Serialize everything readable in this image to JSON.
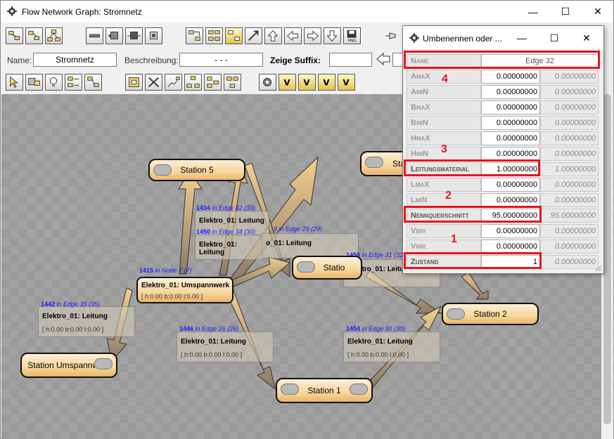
{
  "main_window": {
    "title": "Flow Network Graph: Stromnetz"
  },
  "toolbar": {
    "name_label": "Name:",
    "name_value": "Stromnetz",
    "description_label": "Beschreibung:",
    "description_value": "- - -",
    "suffix_label": "Zeige Suffix:",
    "suffix_value": ""
  },
  "graph": {
    "stations": [
      {
        "label": "Station 5"
      },
      {
        "label": "Station 2"
      },
      {
        "label": "Station 1"
      },
      {
        "label": "Station Umspannwerk"
      },
      {
        "label": "Statio"
      },
      {
        "label": "Sta"
      }
    ],
    "edge_cards": [
      {
        "title": "Elektro_01: Leitung",
        "values": "[ h:0.00 b:0.00 l:0.00 ]"
      },
      {
        "title": "Elektro_01: Leitung",
        "values": "[ h:0.00 b:0.00 l:0.00 ]"
      },
      {
        "title": "Elektro_01: Leitung",
        "values": "[ h:0.00 b:0.00 l:0.00 ]"
      },
      {
        "title": "Elektro_01: Umspannwerk",
        "values": "[ h:0.00 b:0.00 l:0.00 ]"
      },
      {
        "title": "Elektro_01: Leitung",
        "values": ""
      },
      {
        "title": "Elektro_01: Leitung",
        "values": ""
      },
      {
        "title": "o_01: Leitung",
        "values": ""
      },
      {
        "title": "Elektro_01: Leitung",
        "values": ""
      }
    ],
    "blue_labels": [
      {
        "id": "1442",
        "text": " in Edge 35 (35)"
      },
      {
        "id": "1415",
        "text": " in Node 7 (7)"
      },
      {
        "id": "1446",
        "text": " in Edge 26 (26)"
      },
      {
        "id": "1454",
        "text": " in Edge 30 (30)"
      },
      {
        "id": "1434",
        "text": " in Edge 32 (33)"
      },
      {
        "id": "1450",
        "text": " in Edge 34 (30)"
      },
      {
        "id": "",
        "text": "8 in Edge 29 (29)"
      },
      {
        "id": "1458",
        "text": " in Edge 31 (31)"
      }
    ]
  },
  "dialog": {
    "title": "Umbenennen oder ...",
    "rows": [
      {
        "label": "Name",
        "value": "Edge 32"
      },
      {
        "label": "AmaX",
        "value": "0.00000000",
        "value2": "0.00000000"
      },
      {
        "label": "AmiN",
        "value": "0.00000000",
        "value2": "0.00000000"
      },
      {
        "label": "BmaX",
        "value": "0.00000000",
        "value2": "0.00000000"
      },
      {
        "label": "BmiN",
        "value": "0.00000000",
        "value2": "0.00000000"
      },
      {
        "label": "HmaX",
        "value": "0.00000000",
        "value2": "0.00000000"
      },
      {
        "label": "HmiN",
        "value": "0.00000000",
        "value2": "0.00000000"
      },
      {
        "label": "Leitungsmaterial",
        "value": "1.00000000",
        "value2": "1.00000000"
      },
      {
        "label": "LmaX",
        "value": "0.00000000",
        "value2": "0.00000000"
      },
      {
        "label": "LmiN",
        "value": "0.00000000",
        "value2": "0.00000000"
      },
      {
        "label": "Nennquerschnitt",
        "value": "95.00000000",
        "value2": "95.00000000"
      },
      {
        "label": "Vbri",
        "value": "0.00000000",
        "value2": "0.00000000"
      },
      {
        "label": "Vnri",
        "value": "0.00000000",
        "value2": "0.00000000"
      },
      {
        "label": "Zustand",
        "value": "1",
        "value2": "0.00000000"
      }
    ]
  },
  "annotations": [
    "1",
    "2",
    "3",
    "4"
  ],
  "colors": {
    "highlight": "#e8141e",
    "station_fill": "#f7d69a",
    "canvas": "#9a9a9a",
    "link_blue": "#1a1aff"
  }
}
